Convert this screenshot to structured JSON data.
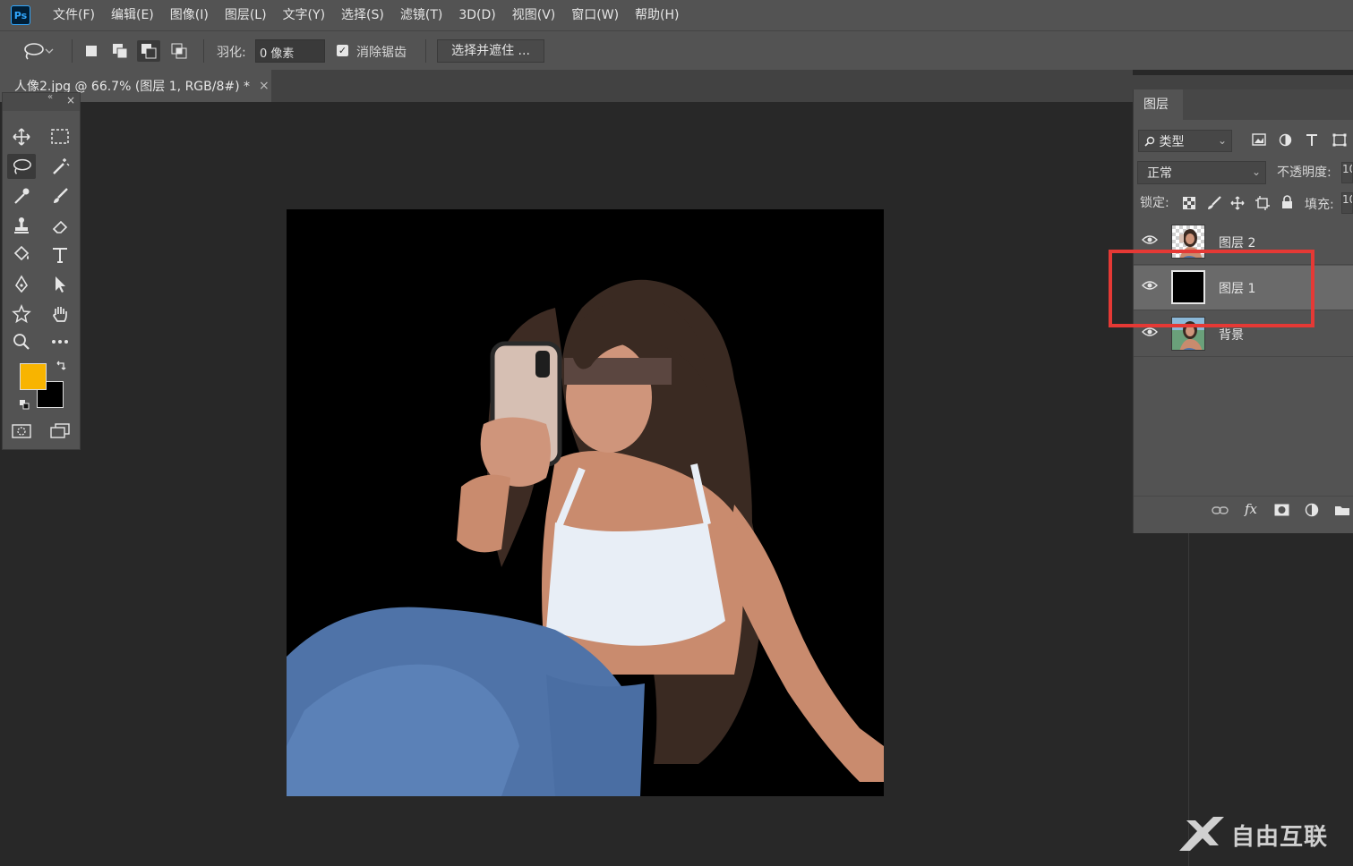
{
  "app": {
    "logo_text": "Ps"
  },
  "menubar": {
    "items": [
      "文件(F)",
      "编辑(E)",
      "图像(I)",
      "图层(L)",
      "文字(Y)",
      "选择(S)",
      "滤镜(T)",
      "3D(D)",
      "视图(V)",
      "窗口(W)",
      "帮助(H)"
    ]
  },
  "options_bar": {
    "feather_label": "羽化:",
    "feather_value": "0 像素",
    "anti_alias_label": "消除锯齿",
    "anti_alias_checked": true,
    "select_and_mask_label": "选择并遮住 ..."
  },
  "document_tab": {
    "label": "人像2.jpg @ 66.7% (图层 1, RGB/8#) *",
    "close_glyph": "×"
  },
  "toolbox": {
    "collapse_glyph": "«",
    "close_glyph": "×",
    "foreground_color": "#f8b400",
    "background_color": "#000000",
    "tools": [
      "move-tool",
      "rect-marquee-tool",
      "lasso-tool",
      "magic-wand-tool",
      "eyedropper-tool",
      "brush-tool",
      "stamp-tool",
      "eraser-tool",
      "paint-bucket-tool",
      "type-tool",
      "pen-tool",
      "path-select-tool",
      "custom-shape-tool",
      "hand-tool",
      "zoom-tool",
      "more-tools",
      "quick-mask",
      "screen-mode"
    ],
    "active_tool": "lasso-tool"
  },
  "layers_panel": {
    "tab_label": "图层",
    "filter_label": "类型",
    "blend_mode": "正常",
    "opacity_label": "不透明度:",
    "opacity_value": "10",
    "lock_label": "锁定:",
    "fill_label": "填充:",
    "fill_value": "10",
    "layers": [
      {
        "name": "图层 2",
        "visible": true,
        "selected": false,
        "thumb": "portrait-transparent"
      },
      {
        "name": "图层 1",
        "visible": true,
        "selected": true,
        "thumb": "black"
      },
      {
        "name": "背景",
        "visible": true,
        "selected": false,
        "thumb": "portrait-photo"
      }
    ],
    "bottom_icons": [
      "link-icon",
      "fx-icon",
      "mask-icon",
      "adjustment-icon",
      "folder-icon"
    ],
    "fx_label": "fx"
  },
  "annotation": {
    "highlight_color": "#e53935",
    "highlighted_layer": "图层 1"
  },
  "watermark": {
    "text": "自由互联"
  }
}
